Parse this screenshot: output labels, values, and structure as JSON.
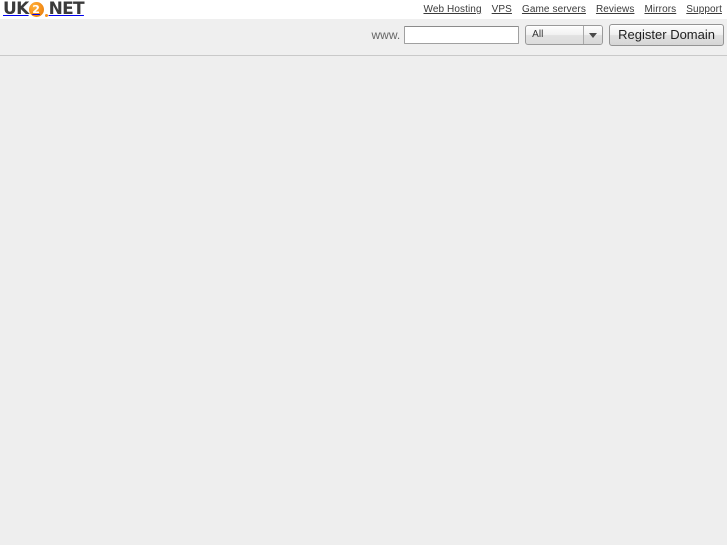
{
  "site": {
    "logo": {
      "prefix": "UK",
      "badge": "2",
      "suffix": "NET",
      "accent_color": "#f7941e",
      "text_color": "#3b3b3b"
    }
  },
  "topnav": {
    "items": [
      {
        "label": "Web Hosting"
      },
      {
        "label": "VPS"
      },
      {
        "label": "Game servers"
      },
      {
        "label": "Reviews"
      },
      {
        "label": "Mirrors"
      },
      {
        "label": "Support"
      }
    ]
  },
  "search": {
    "prefix_label": "www.",
    "domain_value": "",
    "domain_placeholder": "",
    "tld_selected": "All",
    "tld_options": [
      "All"
    ],
    "submit_label": "Register Domain"
  },
  "body": {
    "content": ""
  }
}
